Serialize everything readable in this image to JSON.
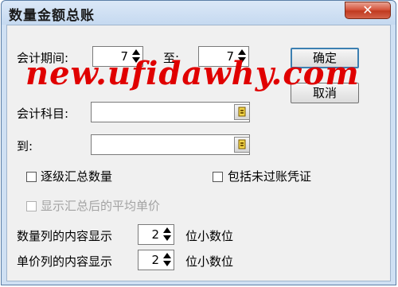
{
  "window": {
    "title": "数量金额总账",
    "close_glyph": "✕"
  },
  "form": {
    "period_label": "会计期间:",
    "period_from": "7",
    "period_to_label": "至:",
    "period_to": "7",
    "account_label": "会计科目:",
    "account_value": "",
    "to_label": "到:",
    "to_value": "",
    "cascade_summary_label": "逐级汇总数量",
    "cascade_summary_checked": false,
    "include_unposted_label": "包括未过账凭证",
    "include_unposted_checked": false,
    "show_avg_price_label": "显示汇总后的平均单价",
    "show_avg_price_checked": false,
    "show_avg_price_disabled": true,
    "qty_column_label": "数量列的内容显示",
    "qty_decimals": "2",
    "qty_unit_label": "位小数位",
    "price_column_label": "单价列的内容显示",
    "price_decimals": "2",
    "price_unit_label": "位小数位"
  },
  "buttons": {
    "ok_label": "确定",
    "cancel_label": "取消"
  },
  "watermark": {
    "text": "new.ufidawhy.com"
  },
  "icons": {
    "spinner_up": "spin-up-icon",
    "spinner_down": "spin-down-icon",
    "lookup": "lookup-icon"
  }
}
